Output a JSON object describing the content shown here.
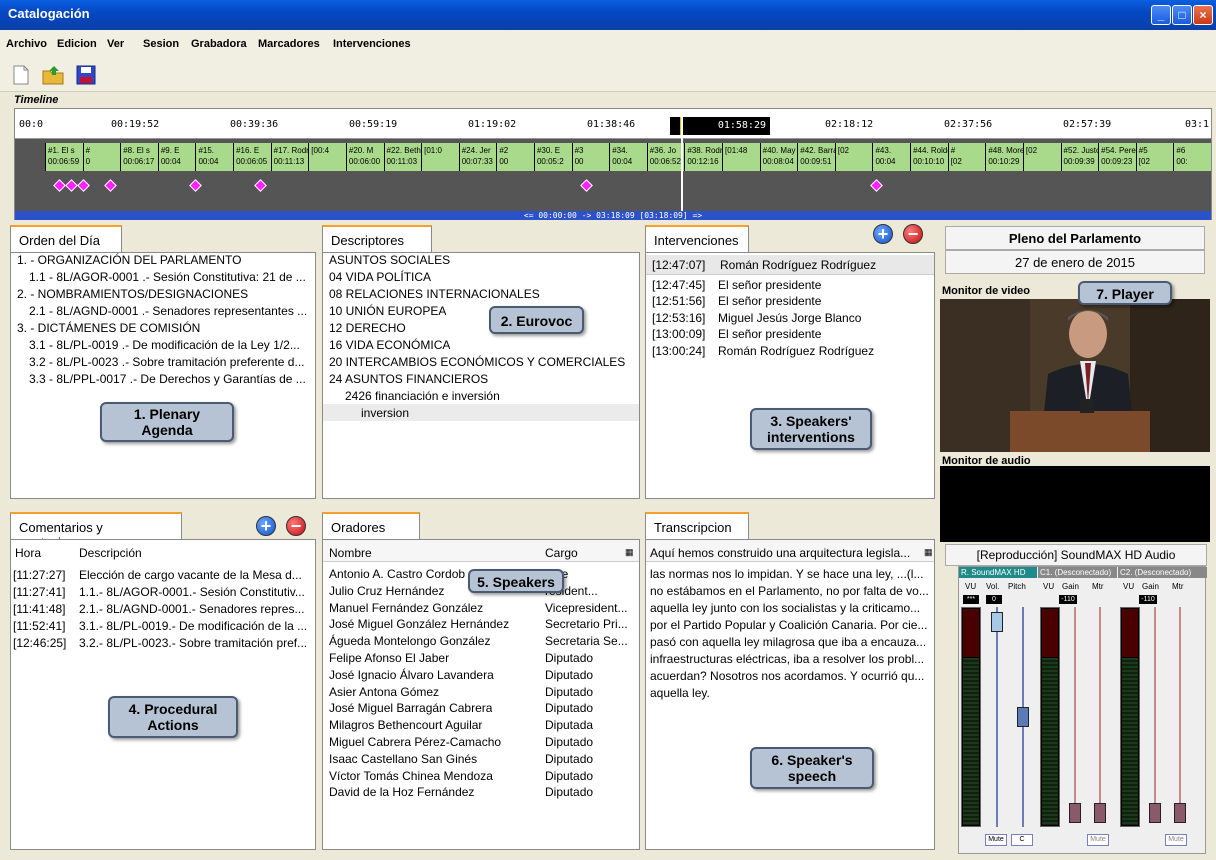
{
  "window": {
    "title": "Catalogación"
  },
  "menu": [
    "Archivo",
    "Edicion",
    "Ver",
    "Sesion",
    "Grabadora",
    "Marcadores",
    "Intervenciones"
  ],
  "timeline": {
    "title": "Timeline",
    "ticks": [
      "00:0",
      "00:19:52",
      "00:39:36",
      "00:59:19",
      "01:19:02",
      "01:38:46",
      "01:58:29",
      "02:18:12",
      "02:37:56",
      "02:57:39",
      "03:1"
    ],
    "playhead": "01:58:29",
    "range": "<= 00:00:00 -> 03:18:09 [03:18:09] =>",
    "segments": [
      {
        "t": "#1. El s",
        "d": "00:06:59"
      },
      {
        "t": "#",
        "d": "0"
      },
      {
        "t": "#8. El s",
        "d": "00:06:17"
      },
      {
        "t": "#9. E",
        "d": "00:04"
      },
      {
        "t": "#15.",
        "d": "00:04"
      },
      {
        "t": "#16. E",
        "d": "00:06:05"
      },
      {
        "t": "#17. Rodrígue",
        "d": "00:11:13"
      },
      {
        "t": "",
        "d": "[00:4"
      },
      {
        "t": "#20. M",
        "d": "00:06:00"
      },
      {
        "t": "#22. Bethenc",
        "d": "00:11:03"
      },
      {
        "t": "",
        "d": "[01:0"
      },
      {
        "t": "#24. Jer",
        "d": "00:07:33"
      },
      {
        "t": "#2",
        "d": "00"
      },
      {
        "t": "#30. E",
        "d": "00:05:2"
      },
      {
        "t": "#3",
        "d": "00"
      },
      {
        "t": "#34.",
        "d": "00:04"
      },
      {
        "t": "#36. Jo",
        "d": "00:06:52"
      },
      {
        "t": "#38. Rodríguez",
        "d": "00:12:16"
      },
      {
        "t": "",
        "d": "[01:48"
      },
      {
        "t": "#40. May",
        "d": "00:08:04"
      },
      {
        "t": "#42. Barrag",
        "d": "00:09:51"
      },
      {
        "t": "",
        "d": "[02"
      },
      {
        "t": "#43.",
        "d": "00:04"
      },
      {
        "t": "#44. Roldós",
        "d": "00:10:10"
      },
      {
        "t": "#",
        "d": "[02"
      },
      {
        "t": "#48. Morera",
        "d": "00:10:29"
      },
      {
        "t": "",
        "d": "[02"
      },
      {
        "t": "#52. Justo",
        "d": "00:09:39"
      },
      {
        "t": "#54. Peresl",
        "d": "00:09:23"
      },
      {
        "t": "#5",
        "d": "[02"
      },
      {
        "t": "#6",
        "d": "00:"
      }
    ]
  },
  "orden": {
    "tab": "Orden del Día",
    "items": [
      "1. - ORGANIZACIÓN DEL PARLAMENTO",
      "1.1 - 8L/AGOR-0001 .- Sesión Constitutiva: 21 de ...",
      "2. - NOMBRAMIENTOS/DESIGNACIONES",
      "2.1 - 8L/AGND-0001 .- Senadores representantes ...",
      "3. - DICTÁMENES DE COMISIÓN",
      "3.1 - 8L/PL-0019 .- De modificación de la Ley 1/2...",
      "3.2 - 8L/PL-0023 .- Sobre tramitación preferente d...",
      "3.3 - 8L/PPL-0017 .- De Derechos y Garantías de ..."
    ],
    "callout": [
      "1. Plenary",
      "Agenda"
    ]
  },
  "descriptores": {
    "tab": "Descriptores",
    "items": [
      "ASUNTOS SOCIALES",
      "04 VIDA POLÍTICA",
      "08 RELACIONES INTERNACIONALES",
      "10 UNIÓN EUROPEA",
      "12 DERECHO",
      "16 VIDA ECONÓMICA",
      "20 INTERCAMBIOS ECONÓMICOS Y COMERCIALES",
      "24 ASUNTOS FINANCIEROS",
      "2426 financiación e inversión",
      "inversion"
    ],
    "callout": "2. Eurovoc"
  },
  "intervenciones": {
    "tab": "Intervenciones",
    "selected_time": "[12:47:07]",
    "selected_name": "Román Rodríguez Rodríguez",
    "rows": [
      {
        "time": "[12:47:45]",
        "name": "El señor presidente"
      },
      {
        "time": "[12:51:56]",
        "name": "El señor presidente"
      },
      {
        "time": "[12:53:16]",
        "name": "Miguel Jesús Jorge Blanco"
      },
      {
        "time": "[13:00:09]",
        "name": "El señor presidente"
      },
      {
        "time": "[13:00:24]",
        "name": "Román Rodríguez Rodríguez"
      }
    ],
    "callout": [
      "3. Speakers'",
      "interventions"
    ]
  },
  "session": {
    "title": "Pleno del Parlamento",
    "date": "27 de enero de 2015"
  },
  "monitor": {
    "video": "Monitor de video",
    "audio": "Monitor de audio",
    "player_callout": "7. Player"
  },
  "mixer": {
    "title": "[Reproducción] SoundMAX HD Audio",
    "ch1": "R. SoundMAX HD",
    "ch2": "C1. (Desconectado)",
    "ch3": "C2. (Desconectado)",
    "labels1": [
      "VU",
      "Vol.",
      "Pitch"
    ],
    "labels2": [
      "VU",
      "Gain",
      "Mtr"
    ],
    "labels3": [
      "VU",
      "Gain",
      "Mtr"
    ],
    "db1": "***",
    "db2": "0",
    "db3": "-110",
    "db4": "-110",
    "mute": "Mute",
    "c": "C"
  },
  "comentarios": {
    "tab": "Comentarios y anotaciones",
    "col_hora": "Hora",
    "col_desc": "Descripción",
    "rows": [
      {
        "h": "[11:27:27]",
        "d": "Elección de cargo vacante de la Mesa d..."
      },
      {
        "h": "[11:27:41]",
        "d": "1.1.- 8L/AGOR-0001.- Sesión Constitutiv..."
      },
      {
        "h": "[11:41:48]",
        "d": "2.1.- 8L/AGND-0001.- Senadores repres..."
      },
      {
        "h": "[11:52:41]",
        "d": "3.1.- 8L/PL-0019.- De modificación de la ..."
      },
      {
        "h": "[12:46:25]",
        "d": "3.2.- 8L/PL-0023.- Sobre tramitación pref..."
      }
    ],
    "callout": [
      "4. Procedural",
      "Actions"
    ]
  },
  "oradores": {
    "tab": "Oradores",
    "col_nombre": "Nombre",
    "col_cargo": "Cargo",
    "rows": [
      {
        "n": "Antonio A. Castro Cordob",
        "c": "ente"
      },
      {
        "n": "Julio Cruz Hernández",
        "c": "resident..."
      },
      {
        "n": "Manuel Fernández González",
        "c": "Vicepresident..."
      },
      {
        "n": "José Miguel González Hernández",
        "c": "Secretario Pri..."
      },
      {
        "n": "Águeda Montelongo González",
        "c": "Secretaria Se..."
      },
      {
        "n": "Felipe Afonso El Jaber",
        "c": "Diputado"
      },
      {
        "n": "José Ignacio Álvaro Lavandera",
        "c": "Diputado"
      },
      {
        "n": "Asier Antona Gómez",
        "c": "Diputado"
      },
      {
        "n": "José Miguel Barragán Cabrera",
        "c": "Diputado"
      },
      {
        "n": "Milagros Bethencourt Aguilar",
        "c": "Diputada"
      },
      {
        "n": "Miguel Cabrera Pérez-Camacho",
        "c": "Diputado"
      },
      {
        "n": "Isaac Castellano San Ginés",
        "c": "Diputado"
      },
      {
        "n": "Víctor Tomás Chinea Mendoza",
        "c": "Diputado"
      },
      {
        "n": "David de la Hoz Fernández",
        "c": "Diputado"
      }
    ],
    "callout": "5. Speakers"
  },
  "transcripcion": {
    "tab": "Transcripcion",
    "lines": [
      "Aquí hemos construido una arquitectura legisla...",
      "las normas nos lo impidan. Y se hace una ley, ...(l...",
      "no estábamos en el Parlamento, no por falta de vo...",
      "aquella ley junto con los socialistas y la criticamo...",
      "por el Partido Popular y Coalición Canaria. Por cie...",
      "pasó con aquella ley milagrosa que iba a encauza...",
      "infraestructuras eléctricas, iba a resolver los probl...",
      "acuerdan? Nosotros nos acordamos. Y ocurrió qu...",
      "aquella ley."
    ],
    "callout": [
      "6. Speaker's",
      "speech"
    ]
  }
}
